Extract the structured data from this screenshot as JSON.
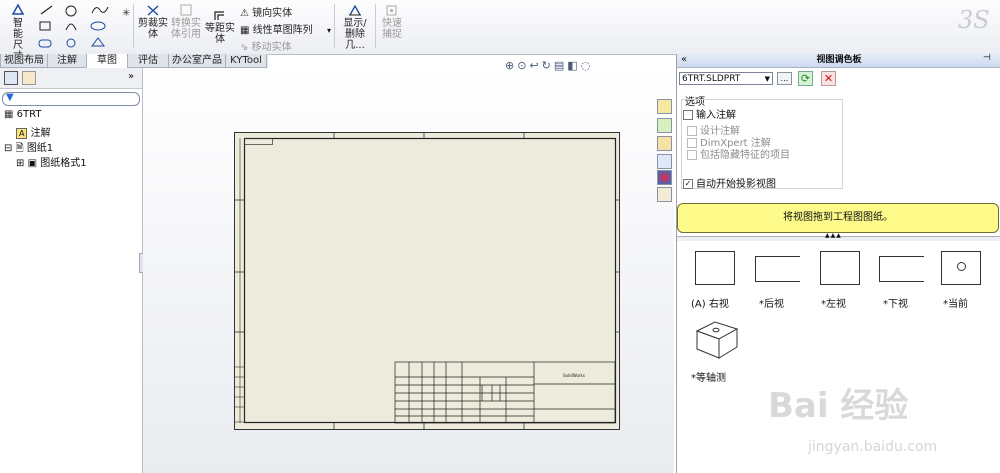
{
  "ribbon": {
    "smart_dimension": "智能尺寸",
    "trim_entities": "剪裁实体",
    "convert_entities": "转换实体引用",
    "offset_entities": "等距实体",
    "mirror_entities": "镜向实体",
    "linear_pattern": "线性草图阵列",
    "move_entities": "移动实体",
    "display_delete": "显示/删除几...",
    "quick_snaps": "快速捕捉"
  },
  "tabs": [
    "视图布局",
    "注解",
    "草图",
    "评估",
    "办公室产品",
    "KYTool"
  ],
  "active_tab": "草图",
  "tree": {
    "root": "6TRT",
    "annotations": "注解",
    "sheet": "图纸1",
    "sheet_format": "图纸格式1"
  },
  "palette": {
    "title": "视图调色板",
    "file": "6TRT.SLDPRT",
    "options_label": "选项",
    "import_annotations": "输入注解",
    "design_annotations": "设计注解",
    "dimxpert": "DimXpert 注解",
    "hidden_features": "包括隐藏特征的项目",
    "auto_projection": "自动开始投影视图",
    "drag_hint": "将视图拖到工程图图纸。",
    "views": [
      "(A) 右视",
      "*后视",
      "*左视",
      "*下视",
      "*当前",
      "*等轴测"
    ]
  },
  "titleblock": {
    "company": "SolidWorks"
  },
  "watermark": {
    "brand": "Bai 经验",
    "url": "jingyan.baidu.com"
  },
  "colors": {
    "sheet": "#ecebdc",
    "hint_yellow": "#fffb8a",
    "palette_header": "#d9e4f5"
  }
}
